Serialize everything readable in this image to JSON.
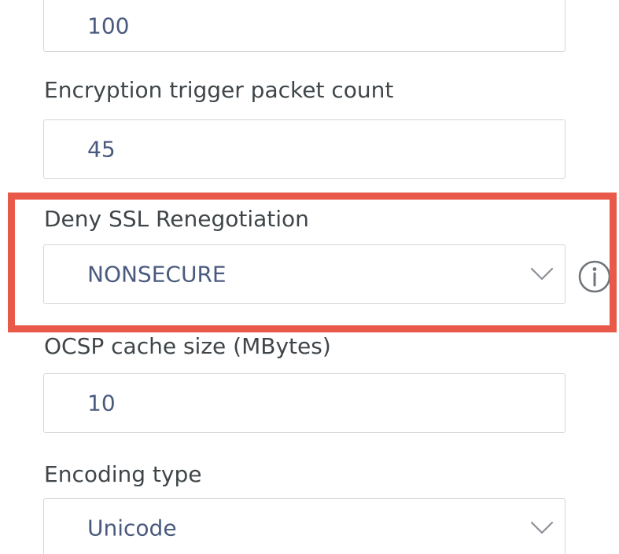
{
  "fields": [
    {
      "label": "",
      "value": "100",
      "type": "input"
    },
    {
      "label": "Encryption trigger packet count",
      "value": "45",
      "type": "input"
    },
    {
      "label": "Deny SSL Renegotiation",
      "value": "NONSECURE",
      "type": "select"
    },
    {
      "label": "OCSP cache size (MBytes)",
      "value": "10",
      "type": "input"
    },
    {
      "label": "Encoding type",
      "value": "Unicode",
      "type": "select"
    }
  ],
  "icons": {
    "dropdown": "chevron-down-icon",
    "info": "info-icon"
  },
  "colors": {
    "highlight": "#e8594a",
    "value_text": "#4a5a7e",
    "label_text": "#3f4549",
    "field_border": "#d2d6da"
  }
}
